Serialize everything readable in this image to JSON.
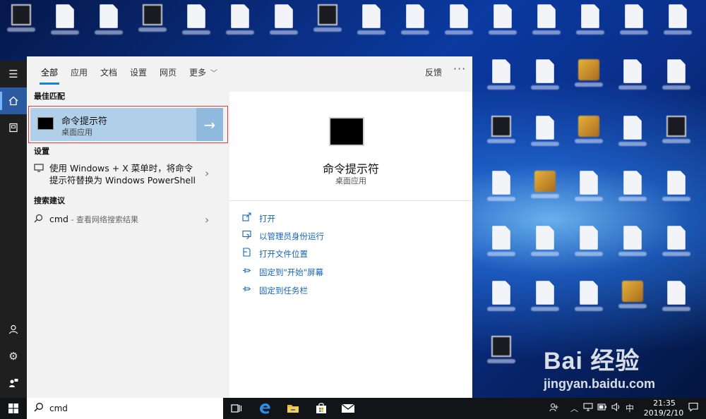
{
  "search_panel": {
    "tabs": [
      {
        "label": "全部",
        "active": true
      },
      {
        "label": "应用",
        "active": false
      },
      {
        "label": "文档",
        "active": false
      },
      {
        "label": "设置",
        "active": false
      },
      {
        "label": "网页",
        "active": false
      },
      {
        "label": "更多",
        "active": false,
        "has_dropdown": true
      }
    ],
    "feedback_label": "反馈",
    "more_options": "···",
    "sections": {
      "best_match": "最佳匹配",
      "settings": "设置",
      "search_suggestions": "搜索建议"
    },
    "best_match": {
      "title": "命令提示符",
      "subtitle": "桌面应用",
      "arrow": "→"
    },
    "settings_result": {
      "text": "使用 Windows + X 菜单时，将命令提示符替换为 Windows PowerShell",
      "icon": "display-icon"
    },
    "web_suggestion": {
      "query": "cmd",
      "hint": " - 查看网络搜索结果",
      "icon": "search-icon"
    },
    "detail": {
      "title": "命令提示符",
      "subtitle": "桌面应用",
      "actions": [
        {
          "label": "打开",
          "icon": "open-icon"
        },
        {
          "label": "以管理员身份运行",
          "icon": "admin-icon"
        },
        {
          "label": "打开文件位置",
          "icon": "folder-icon"
        },
        {
          "label": "固定到\"开始\"屏幕",
          "icon": "pin-icon"
        },
        {
          "label": "固定到任务栏",
          "icon": "pin-icon"
        }
      ]
    }
  },
  "taskbar": {
    "search_value": "cmd",
    "input_method": "中",
    "clock_time": "21:35",
    "clock_date": "2019/2/10"
  },
  "watermark": {
    "logo": "Bai 经验",
    "url": "jingyan.baidu.com"
  },
  "colors": {
    "accent": "#1a7fe0",
    "selection": "#b0d0ea",
    "link": "#1565b5",
    "highlight_box": "#c94545"
  }
}
